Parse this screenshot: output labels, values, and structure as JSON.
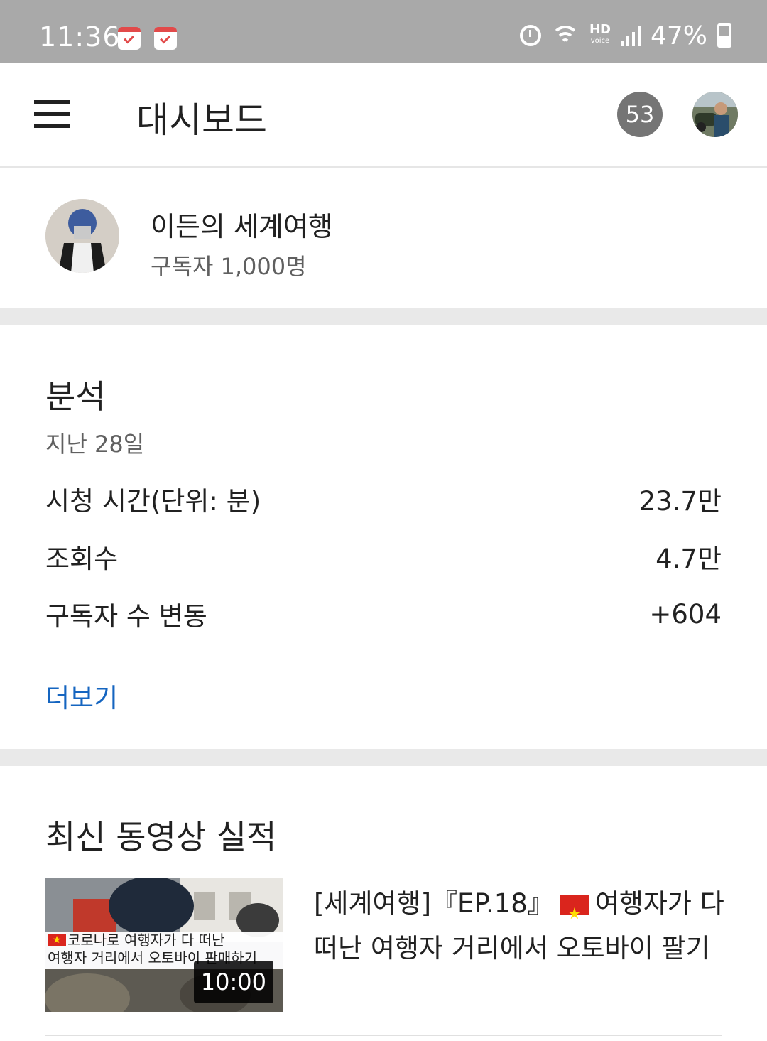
{
  "status_bar": {
    "time": "11:36",
    "battery": "47%",
    "icons": [
      "calendar-icon",
      "calendar-icon",
      "alarm-icon",
      "wifi-icon",
      "hd-voice-icon",
      "signal-icon",
      "battery-icon"
    ],
    "hd_label": "HD",
    "voice_label": "voice"
  },
  "app_bar": {
    "title": "대시보드",
    "notification_count": "53"
  },
  "channel": {
    "name": "이든의 세계여행",
    "subscribers": "구독자 1,000명"
  },
  "analytics": {
    "title": "분석",
    "period": "지난 28일",
    "metrics": [
      {
        "label": "시청 시간(단위: 분)",
        "value": "23.7만"
      },
      {
        "label": "조회수",
        "value": "4.7만"
      },
      {
        "label": "구독자 수 변동",
        "value": "+604"
      }
    ],
    "see_more": "더보기"
  },
  "latest_video": {
    "section_title": "최신 동영상 실적",
    "title_prefix": "[세계여행]『EP.18』",
    "title_suffix": "여행자가 다 떠난 여행자 거리에서 오토바이 팔기",
    "thumbnail_line1": "코로나로 여행자가 다 떠난",
    "thumbnail_line2": "여행자 거리에서 오토바이 판매하기",
    "duration": "10:00",
    "flag_color": "#da251d"
  }
}
